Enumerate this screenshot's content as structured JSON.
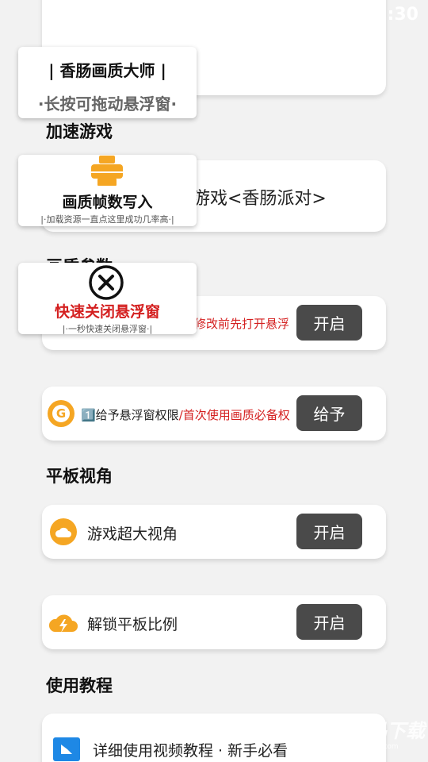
{
  "status_bar": {
    "time": "1:30"
  },
  "floating_title": {
    "title": "| 香肠画质大师 |",
    "subtitle": "·长按可拖动悬浮窗·"
  },
  "floating_write": {
    "title": "画质帧数写入",
    "subtitle": "|·加载资源一直点这里成功几率高·|"
  },
  "floating_close": {
    "title": "快速关闭悬浮窗",
    "subtitle": "|·一秒快速关闭悬浮窗·|"
  },
  "sections": {
    "accelerate": "加速游戏",
    "quality_params": "画质参数",
    "tablet_view": "平板视角",
    "tutorial": "使用教程"
  },
  "game_card": {
    "text": "游戏<香肠派对>"
  },
  "float_card": {
    "text": "修改前先打开悬浮",
    "button": "开启"
  },
  "permission_card": {
    "prefix": "1️⃣给予悬浮窗权限",
    "suffix": "/首次使用画质必备权",
    "button": "给予"
  },
  "wide_view_card": {
    "text": "游戏超大视角",
    "button": "开启"
  },
  "tablet_ratio_card": {
    "text": "解锁平板比例",
    "button": "开启"
  },
  "tutorial_card": {
    "text": "详细使用视频教程 · 新手必看"
  },
  "watermark": {
    "text": "精品下载",
    "sub": "www.jplp.com"
  },
  "colors": {
    "accent_red": "#d42020",
    "button_dark": "#4a4a4a",
    "icon_orange": "#f5a623",
    "icon_blue": "#1e88e5"
  }
}
